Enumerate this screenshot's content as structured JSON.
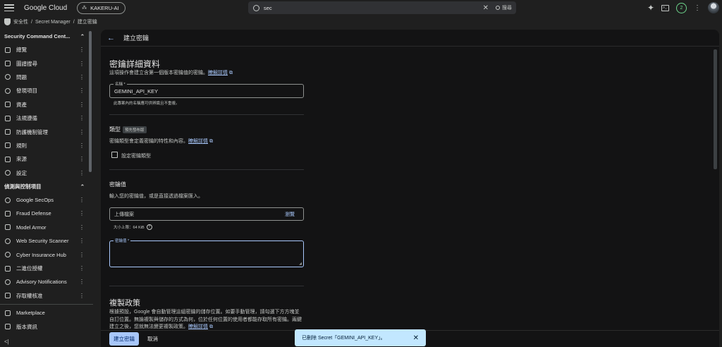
{
  "topbar": {
    "brand": "Google Cloud",
    "project": "KAKERU-AI",
    "search_value": "sec",
    "search_clear": "✕",
    "search_button": "搜尋",
    "notification_count": "2"
  },
  "breadcrumb": {
    "items": [
      "安全性",
      "/",
      "Secret Manager",
      "/",
      "建立密鑰"
    ]
  },
  "sidebar": {
    "group1": "Security Command Cent...",
    "group1_items": [
      "總覽",
      "圖譜搜尋",
      "問題",
      "發現項目",
      "資產",
      "法規遵循",
      "防護機制管理",
      "規則",
      "來源",
      "設定"
    ],
    "group2": "偵測與控制項目",
    "group2_items": [
      "Google SecOps",
      "Fraud Defense",
      "Model Armor",
      "Web Security Scanner",
      "Cyber Insurance Hub",
      "二進位授權",
      "Advisory Notifications",
      "存取權核准"
    ],
    "bottom_items": [
      "Marketplace",
      "版本資訊"
    ],
    "collapse": "<|"
  },
  "page": {
    "title": "建立密鑰",
    "details_heading": "密鑰詳細資料",
    "details_desc": "這項操作會建立含第一個版本密鑰值的密鑰。",
    "learn_more": "瞭解詳情",
    "name_label": "名稱 *",
    "name_value": "GEMINI_API_KEY",
    "name_hint": "此專案內的名稱應可供辨識且不重複。",
    "type_heading": "類型",
    "type_badge": "預先發布版",
    "type_desc": "密鑰類型會定義密鑰的特性和內容。",
    "type_checkbox": "設定密鑰類型",
    "value_heading": "密鑰值",
    "value_desc": "輸入您的密鑰值，或是直接透過檔案匯入。",
    "upload_label": "上傳檔案",
    "browse": "瀏覽",
    "max_size": "大小上限：64 KiB",
    "value_label": "密鑰值 *",
    "replication_heading": "複製政策",
    "replication_desc": "根據預設，Google 會自動管理這組密鑰的儲存位置。如要手動管理，請勾選下方方塊並自訂位置。無論複製與儲存的方式為何，位於任何位置的使用者都能存取所有密鑰。兩鍵建立之後，您就無法變更複製政策。",
    "create_button": "建立密鑰",
    "cancel_button": "取消"
  },
  "toast": {
    "message": "已刪除 Secret「GEMINI_API_KEY」。",
    "close": "✕"
  }
}
